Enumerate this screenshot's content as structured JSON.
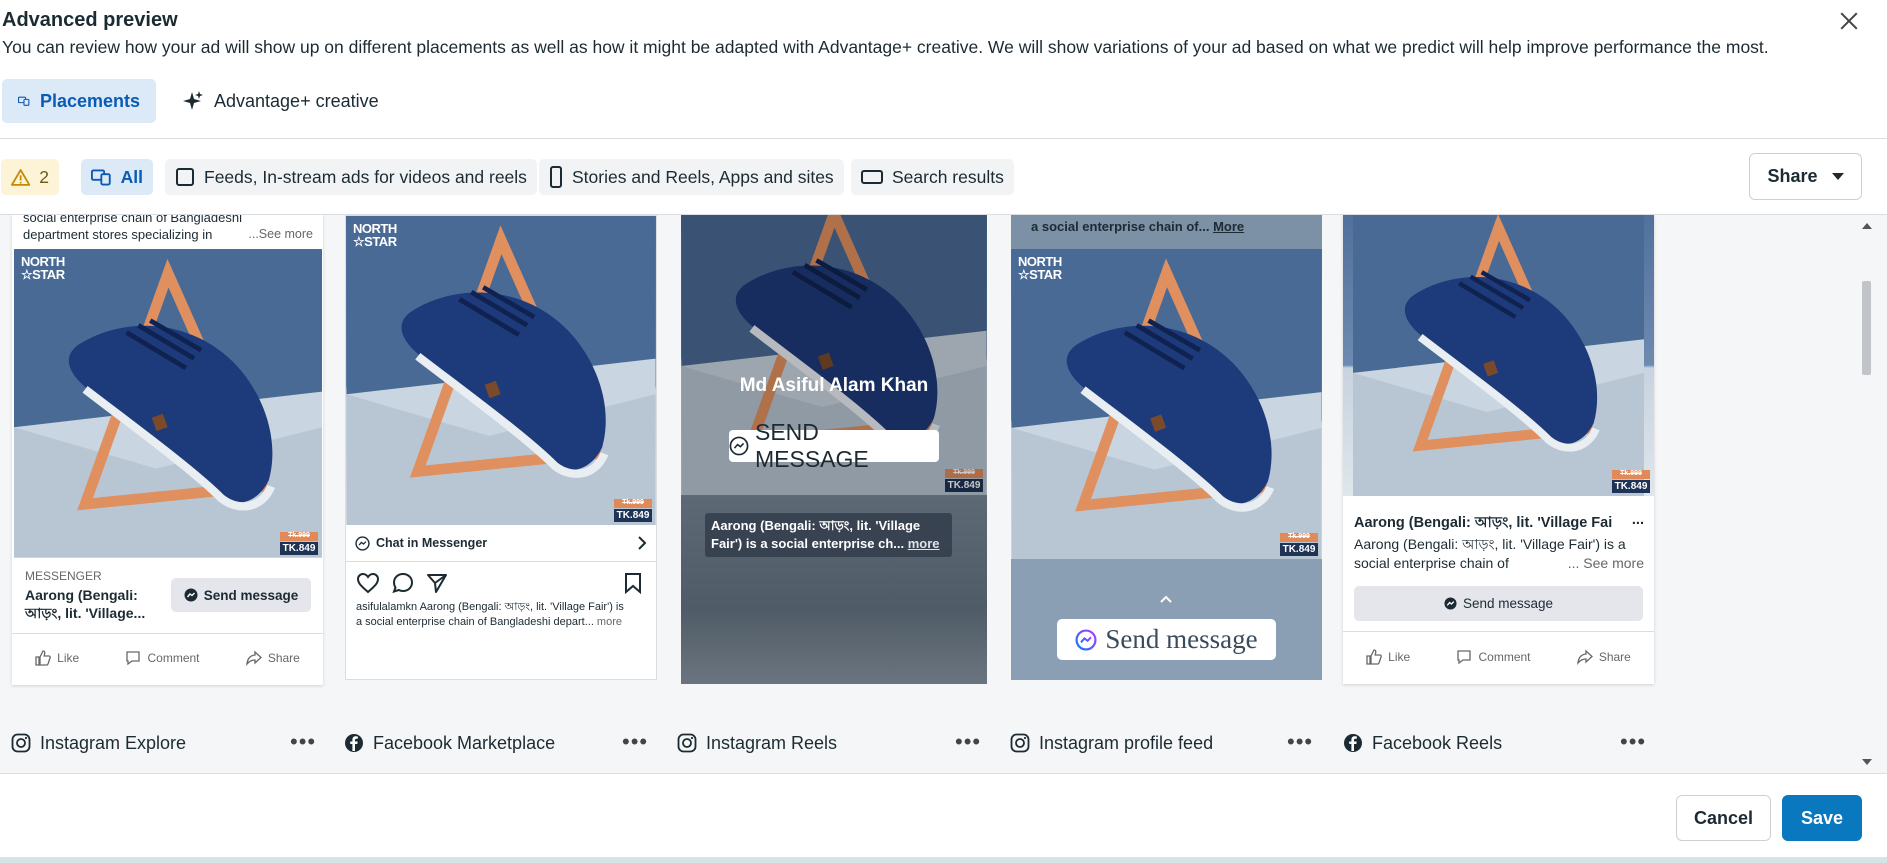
{
  "dialog": {
    "title": "Advanced preview",
    "subtitle": "You can review how your ad will show up on different placements as well as how it might be adapted with Advantage+ creative. We will show variations of your ad based on what we predict will help improve performance the most."
  },
  "tabs": [
    {
      "label": "Placements",
      "icon": "placements-icon",
      "active": true
    },
    {
      "label": "Advantage+ creative",
      "icon": "sparkle-icon",
      "active": false
    }
  ],
  "filters": {
    "warning_count": "2",
    "all_label": "All",
    "feeds_label": "Feeds, In-stream ads for videos and reels",
    "stories_label": "Stories and Reels, Apps and sites",
    "search_label": "Search results"
  },
  "share": {
    "label": "Share"
  },
  "creative": {
    "brand_line1": "NORTH",
    "brand_line2": "☆STAR",
    "price": "TK.849",
    "old_price": "Tk.999"
  },
  "cards": {
    "explore": {
      "top_text_1": "social enterprise chain of Bangladeshi",
      "top_text_2": "department stores specializing in",
      "see_more": "...See more",
      "messenger_label": "MESSENGER",
      "headline_1": "Aarong (Bengali:",
      "headline_2": "আড়ং, lit. 'Village...",
      "send_message": "Send message",
      "like": "Like",
      "comment": "Comment",
      "share": "Share"
    },
    "marketplace": {
      "chat_label": "Chat in Messenger",
      "username": "asifulalamkn",
      "body_1": " Aarong (Bengali: আড়ং, lit. 'Village Fair') is",
      "body_2": "a social enterprise chain of Bangladeshi depart...",
      "more": " more"
    },
    "reels": {
      "name": "Md Asiful Alam Khan",
      "send_message": "SEND MESSAGE",
      "caption_1": "Aarong (Bengali: আড়ং, lit. 'Village",
      "caption_2": "Fair') is a social enterprise ch...",
      "more": "more"
    },
    "profile": {
      "top_text": "a social enterprise chain of...",
      "more": "More",
      "send_message": "Send message"
    },
    "fbreels": {
      "headline": "Aarong (Bengali: আড়ং, lit. 'Village Fai",
      "ellipsis": "...",
      "body_1": "Aarong (Bengali: আড়ং, lit. 'Village Fair') is a",
      "body_2": "social enterprise chain of",
      "see_more": "... See more",
      "send_message": "Send message",
      "like": "Like",
      "comment": "Comment",
      "share": "Share"
    }
  },
  "placements": [
    {
      "label": "Instagram Explore",
      "icon": "instagram-icon"
    },
    {
      "label": "Facebook Marketplace",
      "icon": "facebook-icon"
    },
    {
      "label": "Instagram Reels",
      "icon": "instagram-icon"
    },
    {
      "label": "Instagram profile feed",
      "icon": "instagram-icon"
    },
    {
      "label": "Facebook Reels",
      "icon": "facebook-icon"
    }
  ],
  "footer": {
    "cancel": "Cancel",
    "save": "Save"
  },
  "colors": {
    "accent": "#0a78be",
    "active_tab_bg": "#dce9f7",
    "warning_bg": "#fdf3d7"
  }
}
